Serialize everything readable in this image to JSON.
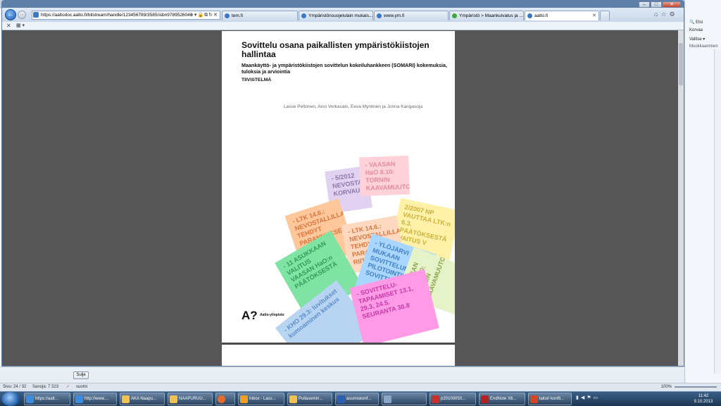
{
  "browser": {
    "address": "https://aaltodoc.aalto.fi/bitstream/handle/123456789/3585/isbn9789526046",
    "address_domain_bold": "aalto.fi",
    "tabs": [
      {
        "label": "tem.fi"
      },
      {
        "label": "Ympäristönsuojelulain mukais..."
      },
      {
        "label": "www.ym.fi"
      },
      {
        "label": "Ympäristö > Maankuivatus ja ..."
      },
      {
        "label": "aalto.fi"
      }
    ]
  },
  "document": {
    "title": "Sovittelu osana paikallisten ympäristökiistojen hallintaa",
    "subtitle": "Maankäyttö- ja ympäristökiistojen sovittelun kokeiluhankkeen (SOMARI) kokemuksia, tuloksia ja arviointia",
    "label": "TIIVISTELMÄ",
    "authors": "Lasse Peltonen, Aino Verkasalo, Eeva Myntinen ja Jonna Kangasoja",
    "logo_mark": "A?",
    "logo_text": "Aalto-yliopisto",
    "notes": [
      {
        "text": "- 11 ASUKKAAN VALITUS VAASAN HaO:n PÄÄTÖKSESTÄ",
        "color": "#7fe3a3"
      },
      {
        "text": "- LTK 14.6.: NEVOSTALLILLA TEHDYT PARANNUKSET RIITTÄVÄT",
        "color": "#ffc79a"
      },
      {
        "text": "- YLÖJÄRVI MUKAAN SOVITTELUN PILOTOINTIIN SOVITTELU",
        "color": "#a9d6ff"
      },
      {
        "text": "2/2007 NP VAUTTAA LTK:n 6.3. PÄÄTÖKSESTÄ VAITUS V",
        "color": "#fff2a8"
      },
      {
        "text": "- SOVITTELU-TAPAAMISET 13.1, 29.3, 24.5. SEURANTA 30.8",
        "color": "#ff9be6"
      },
      {
        "text": "- KHO 29.3: luvitukset kumoaminen keskus",
        "color": "#b7d4f2"
      },
      {
        "text": "- VAASAN HaO 8.10: TORNIN KAAVAMUUTOS",
        "color": "#c9f7d7"
      },
      {
        "text": "- 5/2012 NEVOSTALLI KORVAUSHAKEMUS",
        "color": "#e2d2f2"
      }
    ]
  },
  "ribbon": {
    "items": [
      "Etsi",
      "Korvaa",
      "Valitse",
      "Muokkaaminen"
    ]
  },
  "word": {
    "close_button": "Sulje",
    "status_page": "Sivu: 24 / 32",
    "status_words": "Sanoja: 7 323",
    "status_lang": "suomi",
    "zoom": "100%"
  },
  "taskbar": {
    "items": [
      {
        "label": "https://aalt...",
        "icon_color": "#3b8be0"
      },
      {
        "label": "http://www....",
        "icon_color": "#3b8be0"
      },
      {
        "label": "AKA Naapu...",
        "icon_color": "#f2c14e"
      },
      {
        "label": "NAAPURUU...",
        "icon_color": "#f2c14e"
      },
      {
        "label": "",
        "icon_color": "#e86a2a"
      },
      {
        "label": "Inbox - Lass...",
        "icon_color": "#f0a020"
      },
      {
        "label": "Pullasemin...",
        "icon_color": "#f2c14e"
      },
      {
        "label": "asumiskonf...",
        "icon_color": "#2b5fb4"
      },
      {
        "label": "",
        "icon_color": "#8aa4c8"
      },
      {
        "label": "p20100050...",
        "icon_color": "#c8302a"
      },
      {
        "label": "EndNote X6...",
        "icon_color": "#b22222"
      },
      {
        "label": "laituri konfli...",
        "icon_color": "#d24726"
      }
    ],
    "time": "11:42",
    "date": "9.10.2013"
  }
}
